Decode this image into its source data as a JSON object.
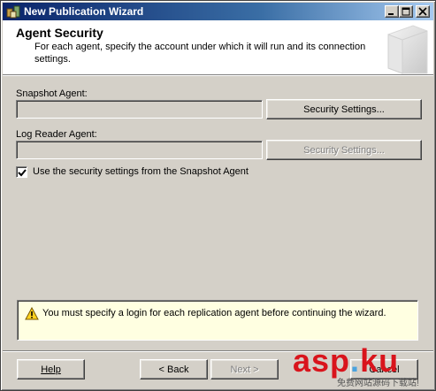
{
  "window": {
    "title": "New Publication Wizard"
  },
  "header": {
    "title": "Agent Security",
    "description": "For each agent, specify the account under which it will run and its connection settings."
  },
  "snapshot_agent": {
    "label": "Snapshot Agent:",
    "value": "",
    "button_label": "Security Settings..."
  },
  "log_reader_agent": {
    "label": "Log Reader Agent:",
    "value": "",
    "button_label": "Security Settings..."
  },
  "use_snapshot_settings": {
    "label": "Use the security settings from the Snapshot Agent",
    "checked": true
  },
  "message": {
    "text": "You must specify a login for each replication agent before continuing the wizard."
  },
  "footer": {
    "help_label": "Help",
    "back_label": "< Back",
    "next_label": "Next >",
    "cancel_label": "Cancel"
  },
  "watermark": {
    "brand_a": "asp",
    "brand_b": "ku",
    "tagline": "免费网站源码下载站!"
  },
  "colors": {
    "titlebar_start": "#0a246a",
    "titlebar_end": "#a6caf0",
    "dialog_bg": "#d4d0c8",
    "message_bg": "#ffffe1",
    "watermark_red": "#d9141c"
  }
}
